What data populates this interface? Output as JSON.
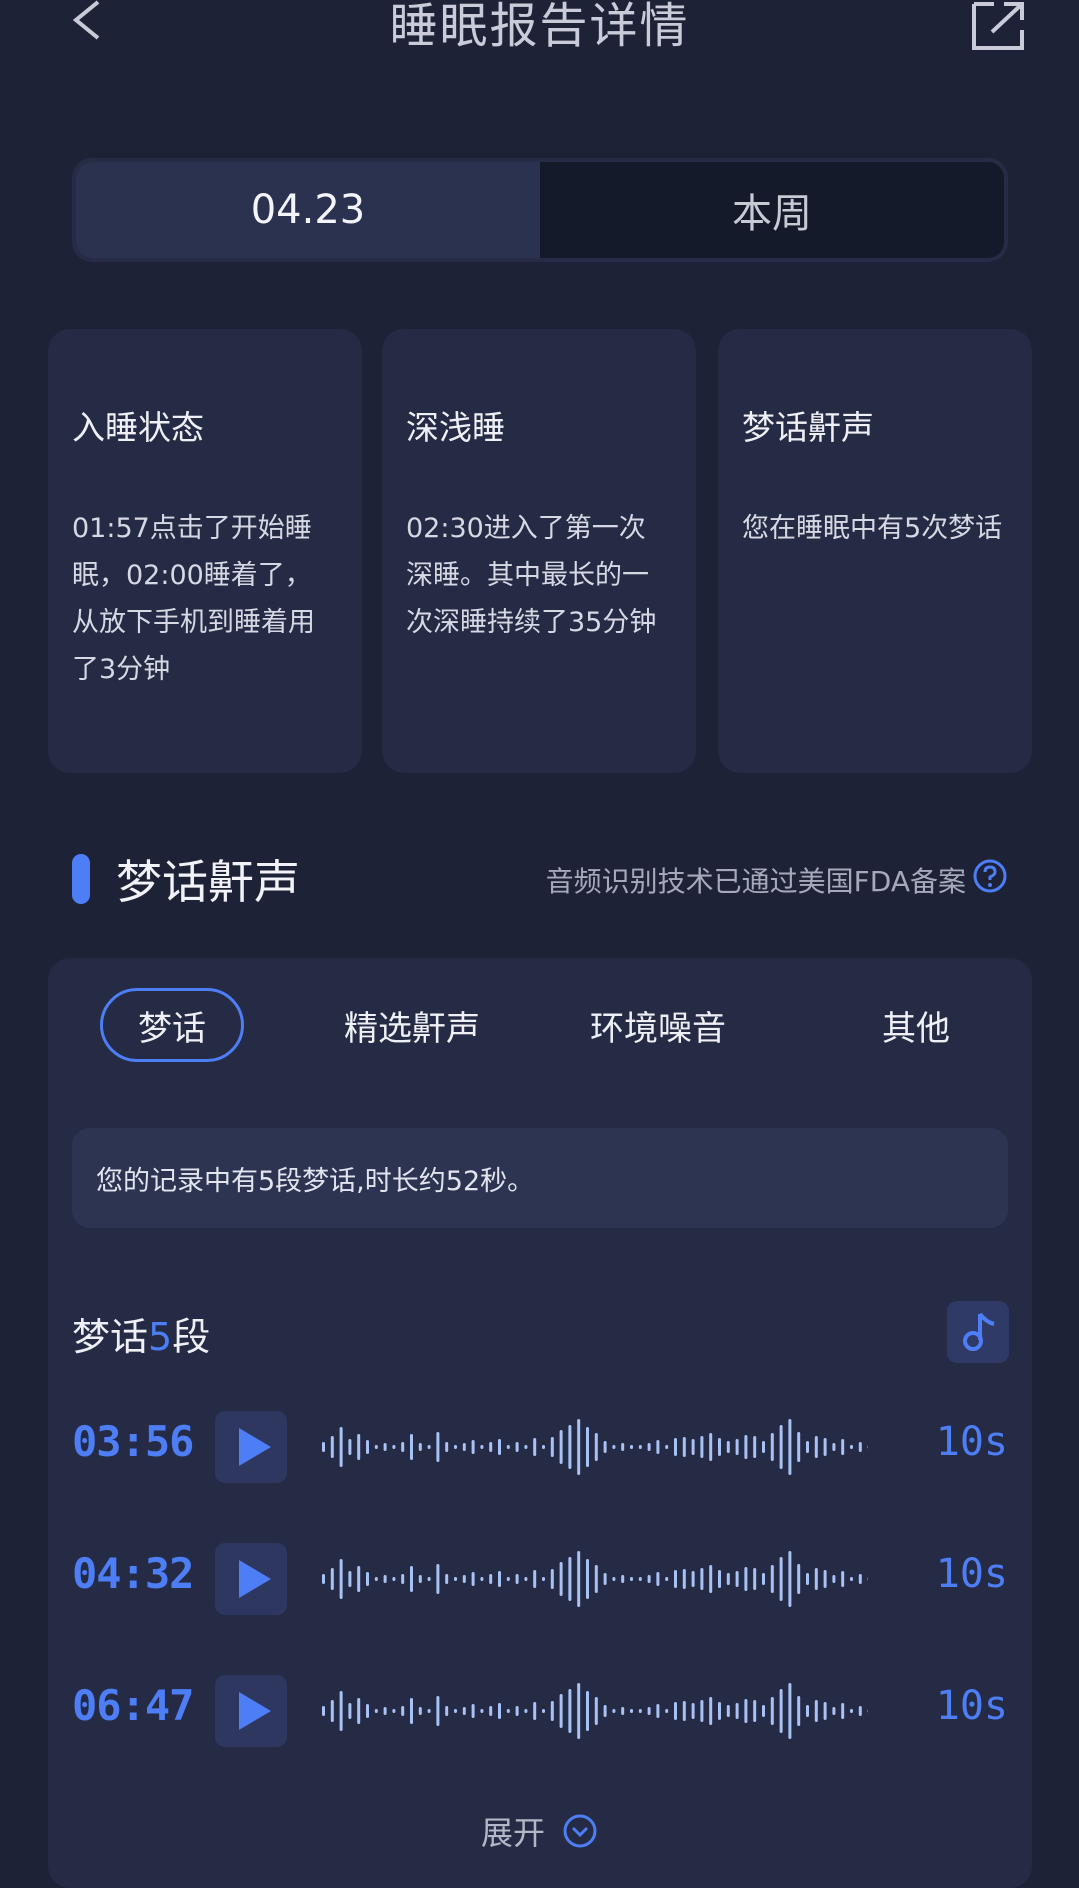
{
  "header": {
    "title": "睡眠报告详情",
    "back_icon": "chevron-left-icon",
    "share_icon": "share-icon"
  },
  "segment": {
    "tabs": [
      "04.23",
      "本周"
    ],
    "selected": 0
  },
  "cards": [
    {
      "title": "入睡状态",
      "body": "01:57点击了开始睡眠，02:00睡着了，从放下手机到睡着用了3分钟"
    },
    {
      "title": "深浅睡",
      "body": "02:30进入了第一次深睡。其中最长的一次深睡持续了35分钟"
    },
    {
      "title": "梦话鼾声",
      "body": "您在睡眠中有5次梦话"
    }
  ],
  "section": {
    "title": "梦话鼾声",
    "note": "音频识别技术已通过美国FDA备案",
    "help_icon": "question-circle-icon"
  },
  "audio_tabs": {
    "items": [
      "梦话",
      "精选鼾声",
      "环境噪音",
      "其他"
    ],
    "selected": 0
  },
  "info_text": "您的记录中有5段梦话,时长约52秒。",
  "recordings_header": {
    "prefix": "梦话",
    "count": "5",
    "suffix": "段",
    "icon": "music-note-icon"
  },
  "recordings": [
    {
      "time": "03:56",
      "duration": "10s"
    },
    {
      "time": "04:32",
      "duration": "10s"
    },
    {
      "time": "06:47",
      "duration": "10s"
    }
  ],
  "expand": {
    "label": "展开",
    "icon": "chevron-down-circle-icon"
  },
  "colors": {
    "background": "#1d2237",
    "card": "#252b44",
    "accent": "#4d7ef5"
  }
}
